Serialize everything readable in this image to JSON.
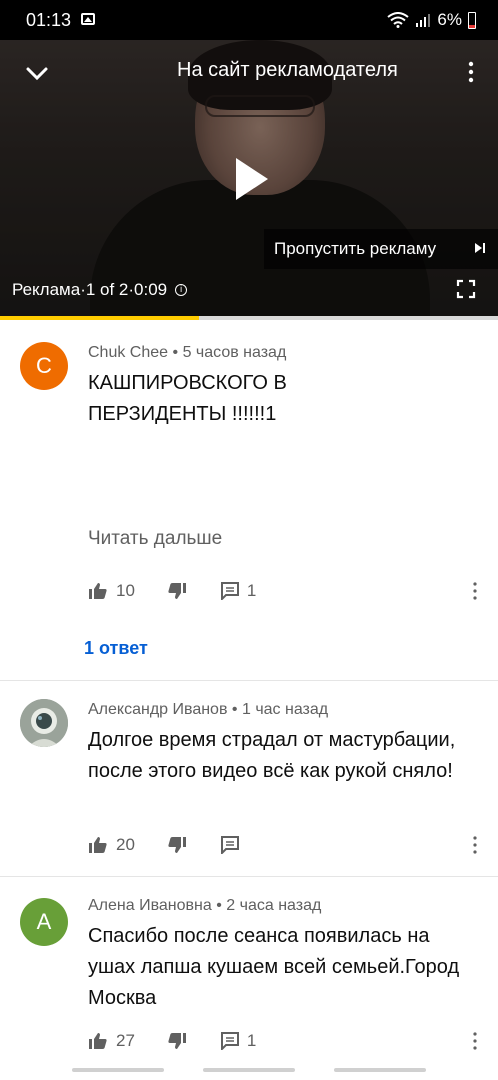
{
  "status_bar": {
    "time": "01:13",
    "battery": "6%"
  },
  "player": {
    "ad_site_label": "На сайт рекламодателя",
    "skip_label": "Пропустить рекламу",
    "ad_info": "Реклама·1 of 2·0:09",
    "progress_fraction": 0.4
  },
  "comments": [
    {
      "avatar_letter": "C",
      "avatar_color": "#ef6c00",
      "author": "Chuk Chee",
      "time": "5 часов назад",
      "text": "КАШПИРОВСКОГО В ПЕРЗИДЕНТЫ !!!!!!1",
      "read_more": "Читать дальше",
      "likes": "10",
      "reply_count": "1",
      "replies_label": "1 ответ"
    },
    {
      "avatar_letter": "",
      "avatar_color": "#9aa39a",
      "author": "Александр Иванов",
      "time": "1 час назад",
      "text": "Долгое время страдал от мастурбации, после этого видео всё как рукой сняло!",
      "likes": "20",
      "reply_count": ""
    },
    {
      "avatar_letter": "A",
      "avatar_color": "#689f38",
      "author": "Алена Ивановна",
      "time": "2 часа назад",
      "text": "Спасибо после сеанса появилась на ушах лапша кушаем всей семьей.Город Москва",
      "likes": "27",
      "reply_count": "1"
    }
  ],
  "meta_separator": "•"
}
